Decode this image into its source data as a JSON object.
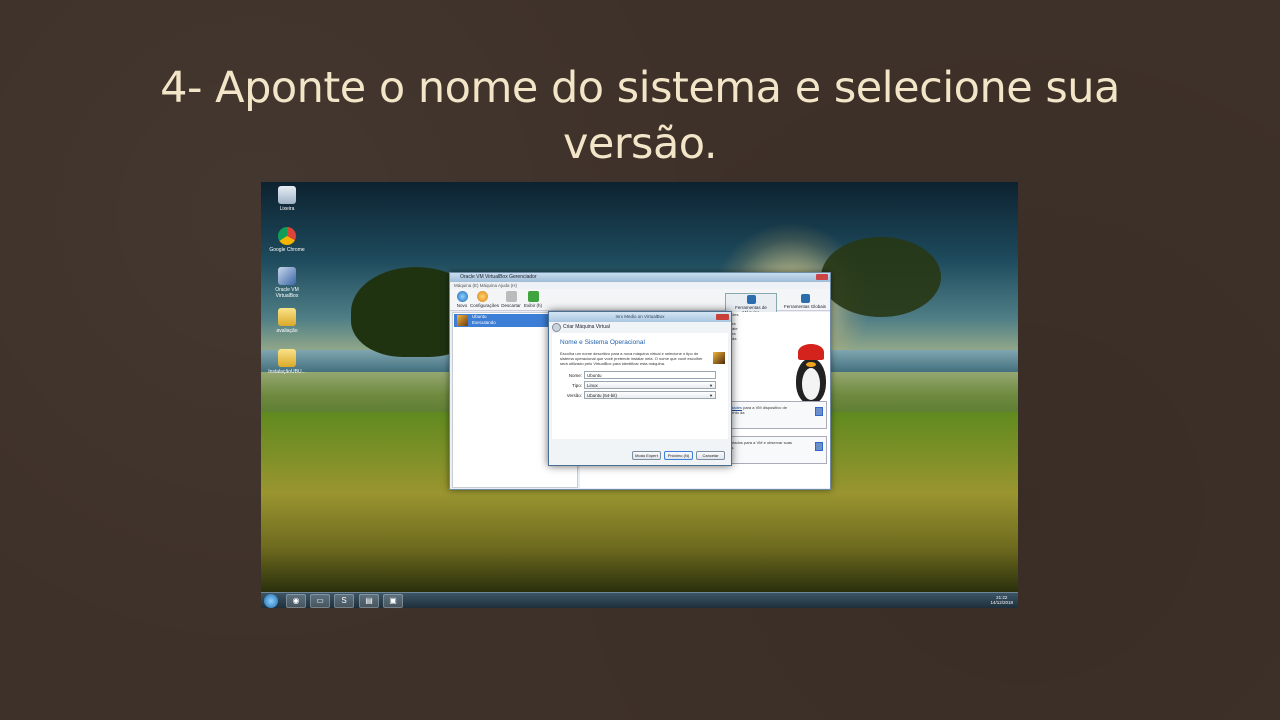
{
  "slide": {
    "title_line1": "4-  Aponte o nome do sistema e selecione sua",
    "title_line2": "versão."
  },
  "desktop": {
    "icons": [
      {
        "label": "Lixeira",
        "icon": "recycle-bin-icon"
      },
      {
        "label": "Google Chrome",
        "icon": "chrome-icon"
      },
      {
        "label": "Oracle VM VirtualBox",
        "icon": "virtualbox-icon"
      },
      {
        "label": "avaliação",
        "icon": "folder-icon"
      },
      {
        "label": "InstalaçãoUBU...",
        "icon": "folder-icon"
      }
    ],
    "taskbar": {
      "tray_time": "21:22",
      "tray_date": "14/12/2018"
    }
  },
  "virtualbox": {
    "window_title": "Oracle VM VirtualBox Gerenciador",
    "menu": "Máquina (E)   Máquina   Ajuda (H)",
    "toolbar": [
      {
        "label": "Novo",
        "icon": "new-icon"
      },
      {
        "label": "Configurações",
        "icon": "settings-icon"
      },
      {
        "label": "Descartar",
        "icon": "discard-icon"
      },
      {
        "label": "Exibir (h)",
        "icon": "show-icon"
      }
    ],
    "tools_right": [
      {
        "label": "Ferramentas de Máquina",
        "icon": "machine-tools-icon"
      },
      {
        "label": "Ferramentas Globais",
        "icon": "global-tools-icon"
      }
    ],
    "vm": {
      "name": "Ubuntu",
      "state": "Executando"
    },
    "info_boxes": [
      {
        "text_pre": "e os ",
        "link": "propriedades",
        "text_post": " para a VM dispositivo de armazenamento da"
      },
      {
        "text_pre": "",
        "link": "Snapshots",
        "text_post": " criados para a VM e observar suas propriedades."
      }
    ],
    "right_snippet": [
      "ões",
      "ra",
      "ate",
      "ra",
      "da"
    ]
  },
  "dialog": {
    "window_title": "Inrx Medio on VirtualBox",
    "header": "Criar Máquina Virtual",
    "heading": "Nome e Sistema Operacional",
    "description": "Escolha um nome descritivo para a nova máquina virtual e selecione o tipo de sistema operacional que você pretende instalar nela. O nome que você escolher será utilizado pelo VirtualBox para identificar esta máquina.",
    "fields": {
      "nome_label": "Nome:",
      "nome_value": "Ubuntu",
      "tipo_label": "Tipo:",
      "tipo_value": "Linux",
      "versao_label": "Versão:",
      "versao_value": "Ubuntu (64-bit)"
    },
    "buttons": {
      "expert": "Modo Expert",
      "next": "Próximo (N)",
      "cancel": "Cancelar"
    }
  }
}
